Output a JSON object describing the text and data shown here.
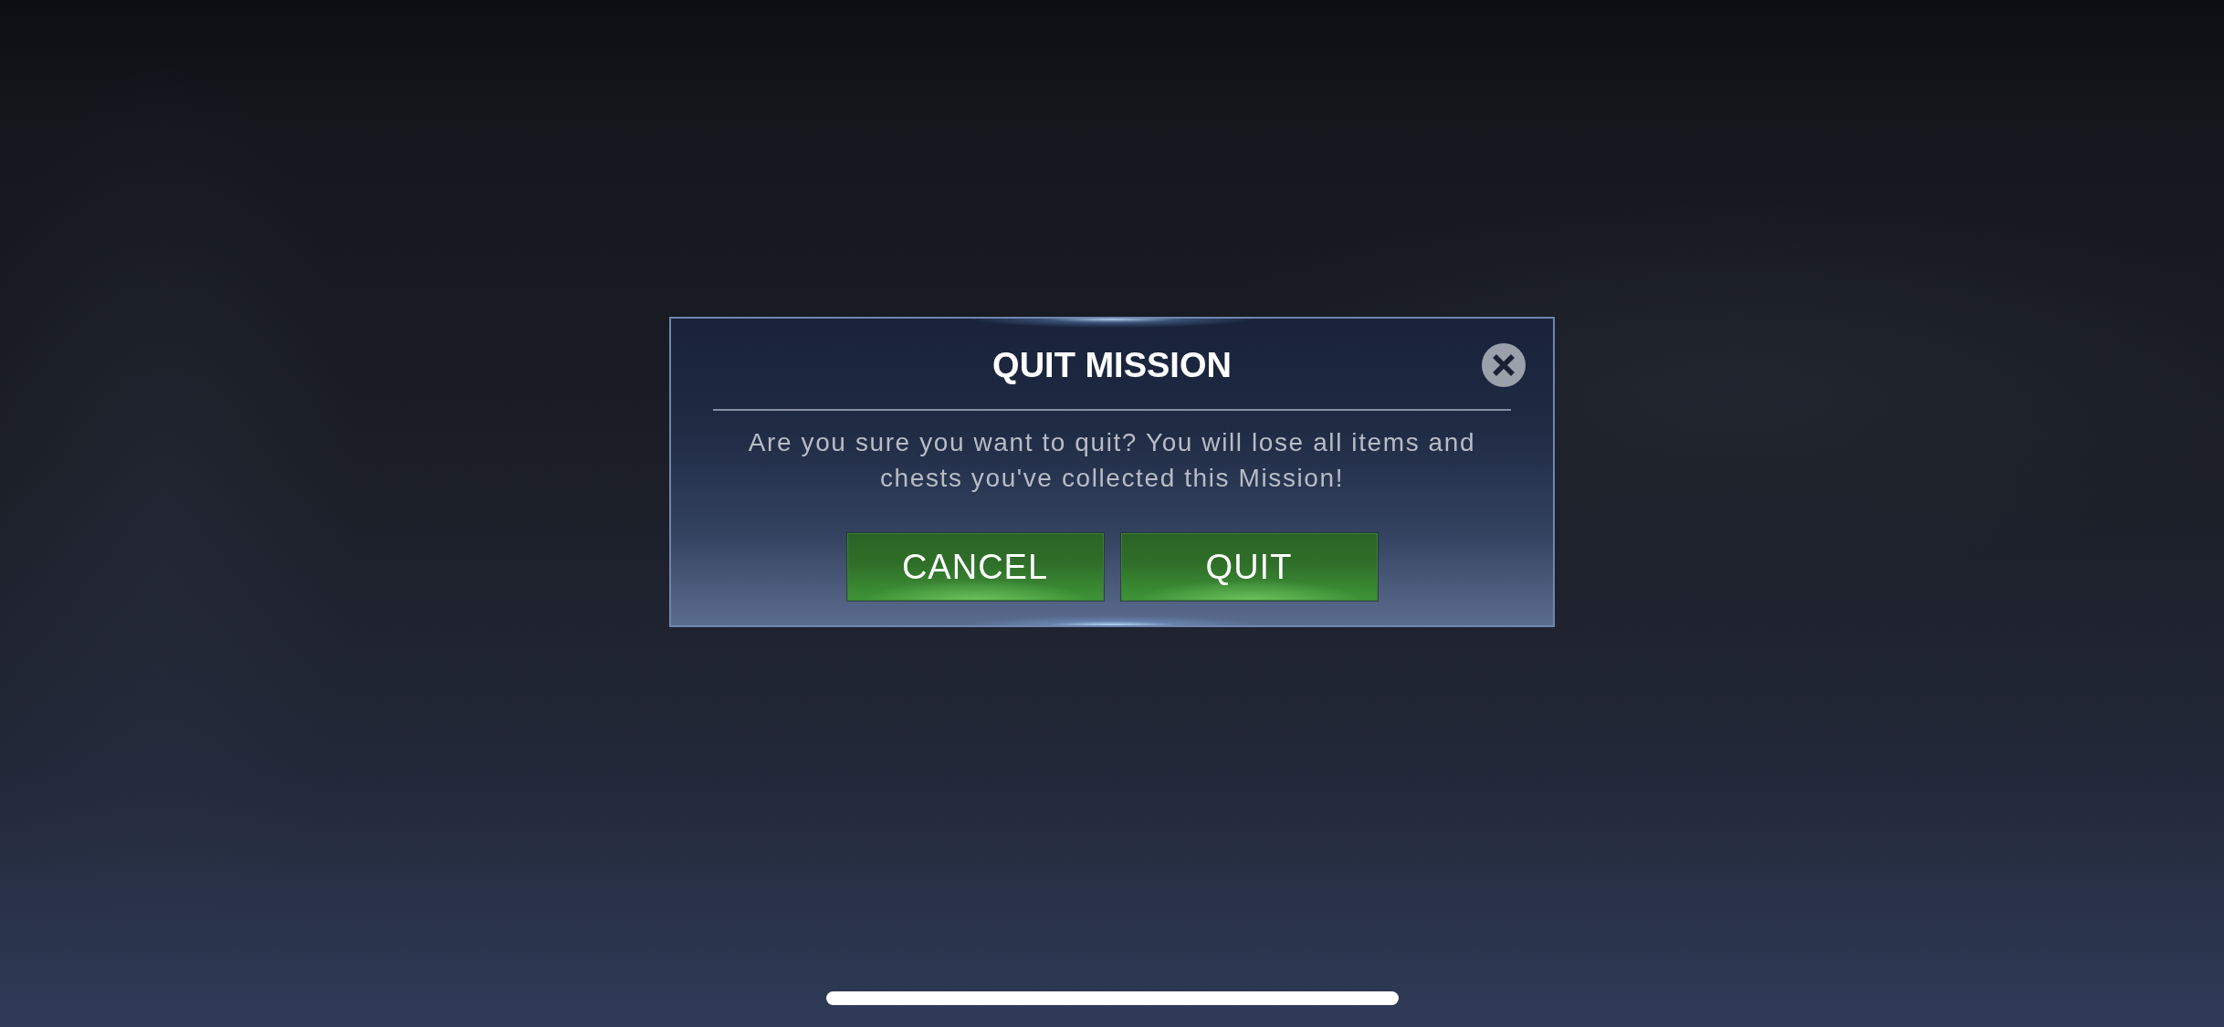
{
  "dialog": {
    "title": "QUIT MISSION",
    "message": "Are you sure you want to quit? You will lose all items and chests you've collected this Mission!",
    "buttons": [
      {
        "label": "CANCEL"
      },
      {
        "label": "QUIT"
      }
    ]
  }
}
